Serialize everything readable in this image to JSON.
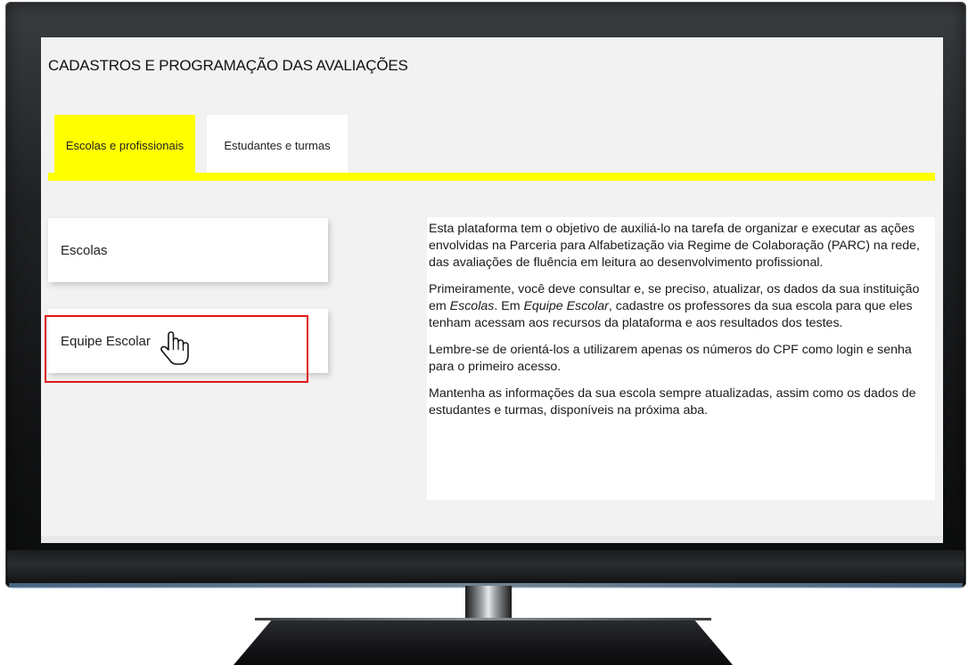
{
  "page": {
    "title": "CADASTROS E PROGRAMAÇÃO DAS AVALIAÇÕES"
  },
  "tabs": [
    {
      "label": "Escolas e profissionais",
      "active": true
    },
    {
      "label": "Estudantes e turmas",
      "active": false
    }
  ],
  "cards": [
    {
      "label": "Escolas"
    },
    {
      "label": "Equipe Escolar"
    }
  ],
  "info": {
    "p1": "Esta plataforma tem o objetivo de auxiliá-lo na tarefa de organizar e executar as ações envolvidas na Parceria para Alfabetização via Regime de Colaboração (PARC) na rede, das avaliações de fluência em leitura ao desenvolvimento profissional.",
    "p2_before": "Primeiramente, você deve consultar e, se preciso, atualizar, os dados da sua instituição em ",
    "p2_em1": "Escolas",
    "p2_mid": ". Em ",
    "p2_em2": "Equipe Escolar",
    "p2_after": ", cadastre os professores da sua escola para que eles tenham acessam aos recursos da plataforma e aos resultados dos testes.",
    "p3": "Lembre-se de orientá-los a utilizarem apenas os números do CPF como login e senha para o primeiro acesso.",
    "p4": "Mantenha as informações da sua escola sempre atualizadas, assim como os dados de estudantes e turmas, disponíveis na próxima aba."
  },
  "colors": {
    "accent": "#ffff00",
    "highlight_border": "#e01818",
    "screen_bg": "#f2f2f2"
  },
  "icons": {
    "cursor": "hand-pointer-icon"
  }
}
